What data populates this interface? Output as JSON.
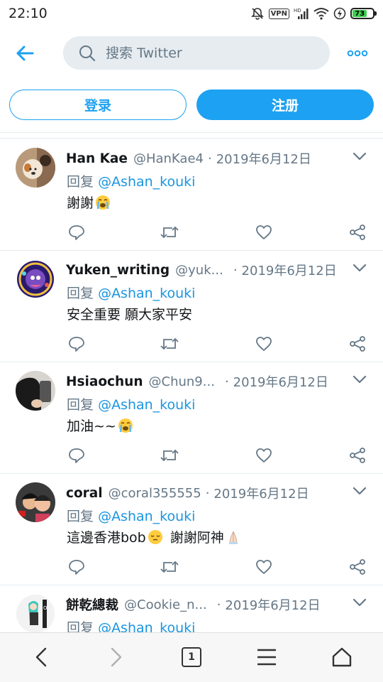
{
  "status_bar": {
    "time": "22:10",
    "vpn_label": "VPN",
    "battery_level": "73",
    "icons": [
      "mute-icon",
      "vpn-icon",
      "signal-icon",
      "wifi-icon",
      "charging-icon",
      "battery-icon"
    ]
  },
  "header": {
    "search_placeholder": "搜索 Twitter",
    "back_icon": "back-arrow-icon",
    "more_icon": "more-dots-icon"
  },
  "auth": {
    "login_label": "登录",
    "signup_label": "注册"
  },
  "colors": {
    "accent": "#1da1f2",
    "link": "#1b95e0",
    "muted": "#657786",
    "text": "#14171a",
    "divider": "#e6ecf0"
  },
  "tweets": [
    {
      "name": "Han Kae",
      "handle": "@HanKae4",
      "dot": "·",
      "date": "2019年6月12日",
      "reply_prefix": "回复",
      "reply_to": "@Ashan_kouki",
      "text": "謝謝",
      "emoji": "crying-face"
    },
    {
      "name": "Yuken_writing",
      "handle": "@yuk...",
      "dot": "·",
      "date": "2019年6月12日",
      "reply_prefix": "回复",
      "reply_to": "@Ashan_kouki",
      "text": "安全重要 願大家平安",
      "emoji": ""
    },
    {
      "name": "Hsiaochun",
      "handle": "@Chun9...",
      "dot": "·",
      "date": "2019年6月12日",
      "reply_prefix": "回复",
      "reply_to": "@Ashan_kouki",
      "text": "加油~~",
      "emoji": "crying-face"
    },
    {
      "name": "coral",
      "handle": "@coral355555",
      "dot": "·",
      "date": "2019年6月12日",
      "reply_prefix": "回复",
      "reply_to": "@Ashan_kouki",
      "text": "這邊香港bob",
      "text2": " 謝謝阿神",
      "emoji": "relieved-face",
      "emoji2": "folded-hands"
    },
    {
      "name": "餅乾總裁",
      "handle": "@Cookie_n...",
      "dot": "·",
      "date": "2019年6月12日",
      "reply_prefix": "回复",
      "reply_to": "@Ashan_kouki",
      "text": "",
      "emoji": ""
    }
  ],
  "bottom_nav": {
    "tab_count": "1",
    "icons": [
      "nav-back-icon",
      "nav-forward-icon",
      "tabs-icon",
      "menu-icon",
      "home-icon"
    ]
  }
}
